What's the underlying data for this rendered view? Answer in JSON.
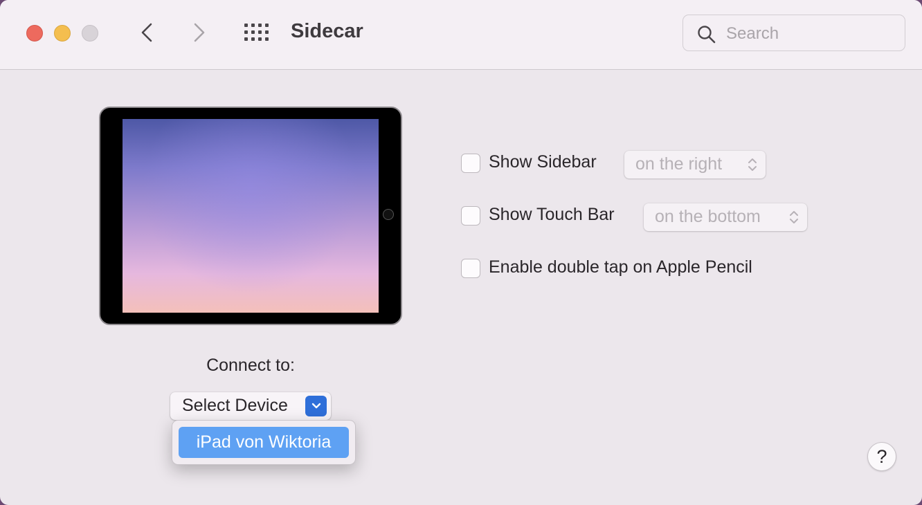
{
  "window": {
    "title": "Sidecar"
  },
  "toolbar": {
    "back_icon": "chevron-left-icon",
    "forward_icon": "chevron-right-icon",
    "grid_icon": "grid-icon"
  },
  "search": {
    "placeholder": "Search",
    "value": ""
  },
  "device_preview": {
    "icon": "ipad-icon"
  },
  "connect": {
    "label": "Connect to:",
    "select_label": "Select Device",
    "options": [
      "iPad von Wiktoria"
    ],
    "highlighted_option": "iPad von Wiktoria"
  },
  "options": {
    "show_sidebar": {
      "label": "Show Sidebar",
      "checked": false,
      "position_value": "on the right"
    },
    "show_touch_bar": {
      "label": "Show Touch Bar",
      "checked": false,
      "position_value": "on the bottom"
    },
    "double_tap": {
      "label": "Enable double tap on Apple Pencil",
      "checked": false
    }
  },
  "help": {
    "label": "?"
  },
  "colors": {
    "accent": "#2f6fd9",
    "highlight": "#5ea1f3",
    "close": "#ed6a5e",
    "minimize": "#f4be4f",
    "zoom_disabled": "#d8d3d8"
  }
}
